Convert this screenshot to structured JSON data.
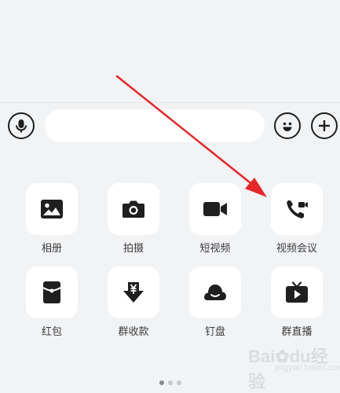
{
  "input_bar": {
    "voice_icon": "microphone-icon",
    "emoji_icon": "smiley-icon",
    "plus_icon": "plus-icon",
    "message_value": ""
  },
  "panel": {
    "tiles": [
      {
        "label": "相册",
        "icon": "image-icon"
      },
      {
        "label": "拍摄",
        "icon": "camera-icon"
      },
      {
        "label": "短视频",
        "icon": "video-icon"
      },
      {
        "label": "视频会议",
        "icon": "video-call-icon"
      },
      {
        "label": "红包",
        "icon": "red-packet-icon"
      },
      {
        "label": "群收款",
        "icon": "yuan-collect-icon"
      },
      {
        "label": "钉盘",
        "icon": "cloud-disk-icon"
      },
      {
        "label": "群直播",
        "icon": "live-tv-icon"
      }
    ],
    "page_indicator": {
      "pages": 3,
      "current": 1
    }
  },
  "annotation": {
    "arrow_color": "#e8262b"
  },
  "watermark": {
    "logo": "Bai",
    "paw": "du",
    "suffix": "经验",
    "url": "jingyan.baidu.com"
  },
  "colors": {
    "icon": "#1f1f1f",
    "background": "#f2f3f5",
    "tile": "#ffffff"
  }
}
